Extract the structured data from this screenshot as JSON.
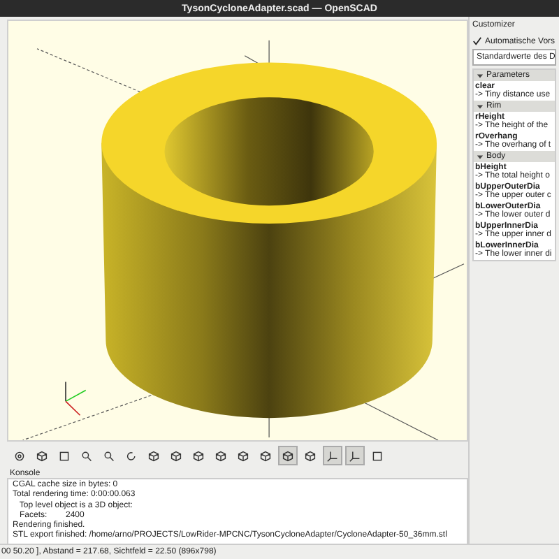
{
  "window": {
    "title": "TysonCycloneAdapter.scad — OpenSCAD"
  },
  "toolbar": [
    {
      "kind": "render",
      "selected": false
    },
    {
      "kind": "cube",
      "selected": false
    },
    {
      "kind": "fit",
      "selected": false
    },
    {
      "kind": "zoomin",
      "selected": false
    },
    {
      "kind": "zoomout",
      "selected": false
    },
    {
      "kind": "reset",
      "selected": false
    },
    {
      "kind": "view",
      "selected": false
    },
    {
      "kind": "view",
      "selected": false
    },
    {
      "kind": "view",
      "selected": false
    },
    {
      "kind": "view",
      "selected": false
    },
    {
      "kind": "view",
      "selected": false
    },
    {
      "kind": "view",
      "selected": false
    },
    {
      "kind": "perspective",
      "selected": true
    },
    {
      "kind": "orthogonal",
      "selected": false
    },
    {
      "kind": "axes",
      "selected": true
    },
    {
      "kind": "scales",
      "selected": true
    },
    {
      "kind": "edges",
      "selected": false
    }
  ],
  "console": {
    "title": "Konsole",
    "lines": [
      "CGAL cache size in bytes: 0",
      "Total rendering time: 0:00:00.063",
      "   Top level object is a 3D object:",
      "   Facets:        2400",
      "Rendering finished.",
      "STL export finished: /home/arno/PROJECTS/LowRider-MPCNC/TysonCycloneAdapter/CycloneAdapter-50_36mm.stl"
    ]
  },
  "status_bar": "00 50.20 ], Abstand = 217.68, Sichtfeld = 22.50 (896x798)",
  "customizer": {
    "title": "Customizer",
    "auto_preview": {
      "label": "Automatische Vors",
      "checked": true
    },
    "preset": "Standardwerte des D",
    "sections": [
      {
        "title": "Parameters",
        "expanded": true,
        "params": [
          {
            "name": "clear",
            "desc": "-> Tiny distance use"
          }
        ]
      },
      {
        "title": "Rim",
        "expanded": true,
        "params": [
          {
            "name": "rHeight",
            "desc": "-> The height of the"
          },
          {
            "name": "rOverhang",
            "desc": "-> The overhang of t"
          }
        ]
      },
      {
        "title": "Body",
        "expanded": true,
        "params": [
          {
            "name": "bHeight",
            "desc": "-> The total height o"
          },
          {
            "name": "bUpperOuterDia",
            "desc": "-> The upper outer c"
          },
          {
            "name": "bLowerOuterDia",
            "desc": "-> The lower outer d"
          },
          {
            "name": "bUpperInnerDia",
            "desc": "-> The upper inner d"
          },
          {
            "name": "bLowerInnerDia",
            "desc": "-> The lower inner di"
          }
        ]
      }
    ]
  }
}
